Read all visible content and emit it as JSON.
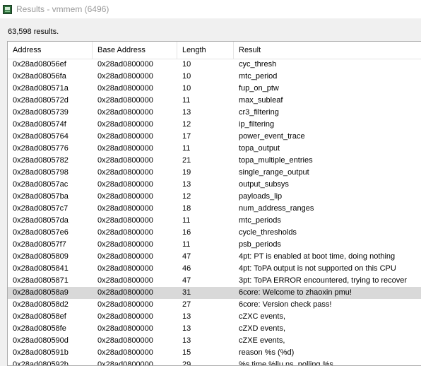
{
  "window": {
    "title": "Results - vmmem (6496)"
  },
  "summary": "63,598 results.",
  "columns": [
    "Address",
    "Base Address",
    "Length",
    "Result"
  ],
  "selected_row_index": 23,
  "rows": [
    {
      "address": "0x28ad08056ef",
      "base": "0x28ad0800000",
      "length": "10",
      "result": "cyc_thresh"
    },
    {
      "address": "0x28ad08056fa",
      "base": "0x28ad0800000",
      "length": "10",
      "result": "mtc_period"
    },
    {
      "address": "0x28ad080571a",
      "base": "0x28ad0800000",
      "length": "10",
      "result": "fup_on_ptw"
    },
    {
      "address": "0x28ad080572d",
      "base": "0x28ad0800000",
      "length": "11",
      "result": "max_subleaf"
    },
    {
      "address": "0x28ad0805739",
      "base": "0x28ad0800000",
      "length": "13",
      "result": "cr3_filtering"
    },
    {
      "address": "0x28ad080574f",
      "base": "0x28ad0800000",
      "length": "12",
      "result": "ip_filtering"
    },
    {
      "address": "0x28ad0805764",
      "base": "0x28ad0800000",
      "length": "17",
      "result": "power_event_trace"
    },
    {
      "address": "0x28ad0805776",
      "base": "0x28ad0800000",
      "length": "11",
      "result": "topa_output"
    },
    {
      "address": "0x28ad0805782",
      "base": "0x28ad0800000",
      "length": "21",
      "result": "topa_multiple_entries"
    },
    {
      "address": "0x28ad0805798",
      "base": "0x28ad0800000",
      "length": "19",
      "result": "single_range_output"
    },
    {
      "address": "0x28ad08057ac",
      "base": "0x28ad0800000",
      "length": "13",
      "result": "output_subsys"
    },
    {
      "address": "0x28ad08057ba",
      "base": "0x28ad0800000",
      "length": "12",
      "result": "payloads_lip"
    },
    {
      "address": "0x28ad08057c7",
      "base": "0x28ad0800000",
      "length": "18",
      "result": "num_address_ranges"
    },
    {
      "address": "0x28ad08057da",
      "base": "0x28ad0800000",
      "length": "11",
      "result": "mtc_periods"
    },
    {
      "address": "0x28ad08057e6",
      "base": "0x28ad0800000",
      "length": "16",
      "result": "cycle_thresholds"
    },
    {
      "address": "0x28ad08057f7",
      "base": "0x28ad0800000",
      "length": "11",
      "result": "psb_periods"
    },
    {
      "address": "0x28ad0805809",
      "base": "0x28ad0800000",
      "length": "47",
      "result": "4pt: PT is enabled at boot time, doing nothing"
    },
    {
      "address": "0x28ad0805841",
      "base": "0x28ad0800000",
      "length": "46",
      "result": "4pt: ToPA output is not supported on this CPU"
    },
    {
      "address": "0x28ad0805871",
      "base": "0x28ad0800000",
      "length": "47",
      "result": "3pt: ToPA ERROR encountered, trying to recover"
    },
    {
      "address": "0x28ad08058a9",
      "base": "0x28ad0800000",
      "length": "31",
      "result": "6core: Welcome to zhaoxin pmu!"
    },
    {
      "address": "0x28ad08058d2",
      "base": "0x28ad0800000",
      "length": "27",
      "result": "6core: Version check pass!"
    },
    {
      "address": "0x28ad08058ef",
      "base": "0x28ad0800000",
      "length": "13",
      "result": "cZXC events,"
    },
    {
      "address": "0x28ad08058fe",
      "base": "0x28ad0800000",
      "length": "13",
      "result": "cZXD events,"
    },
    {
      "address": "0x28ad080590d",
      "base": "0x28ad0800000",
      "length": "13",
      "result": "cZXE events,"
    },
    {
      "address": "0x28ad080591b",
      "base": "0x28ad0800000",
      "length": "15",
      "result": "reason %s (%d)"
    },
    {
      "address": "0x28ad080592b",
      "base": "0x28ad0800000",
      "length": "29",
      "result": "%s time %llu ns, polling %s"
    }
  ]
}
